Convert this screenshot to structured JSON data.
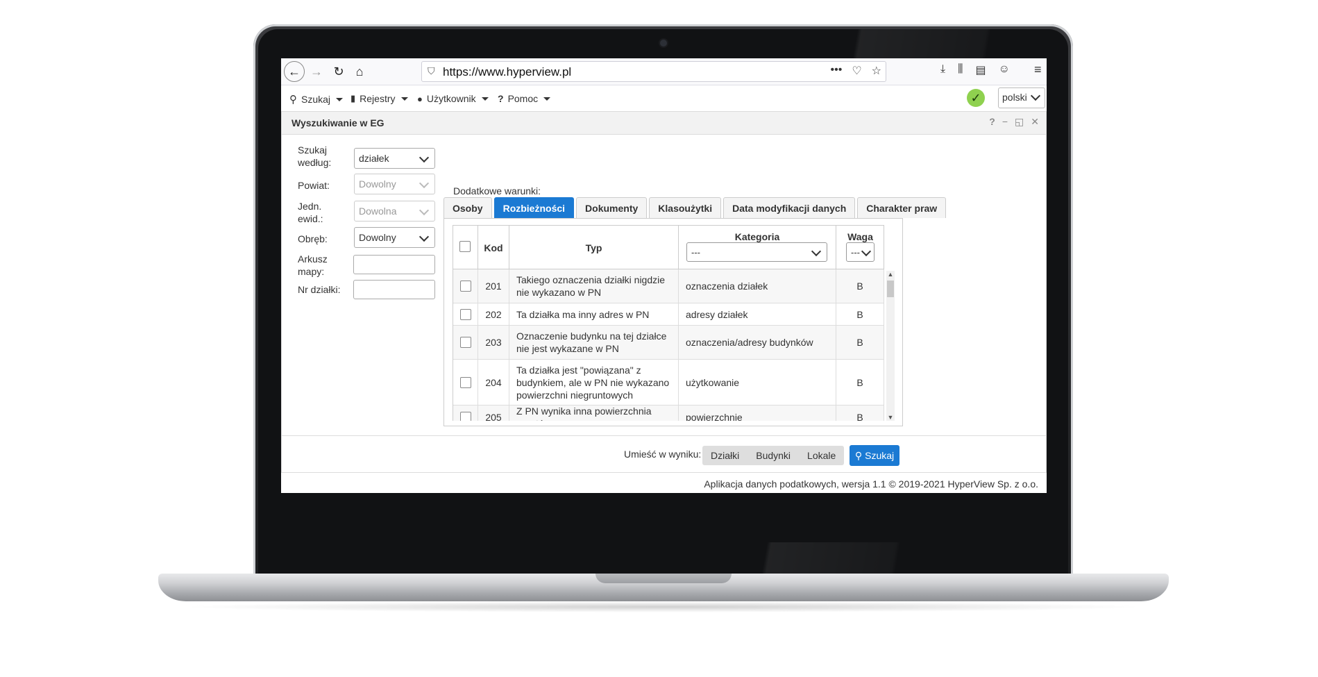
{
  "browser": {
    "url": "https://www.hyperview.pl"
  },
  "menu": {
    "search": "Szukaj",
    "registers": "Rejestry",
    "user": "Użytkownik",
    "help": "Pomoc",
    "help_glyph": "?",
    "language": "polski"
  },
  "panel": {
    "title": "Wyszukiwanie w EG",
    "help_glyph": "?"
  },
  "form": {
    "search_by_label": "Szukaj według:",
    "search_by_value": "działek",
    "county_label": "Powiat:",
    "county_value": "Dowolny",
    "unit_label": "Jedn. ewid.:",
    "unit_value": "Dowolna",
    "precinct_label": "Obręb:",
    "precinct_value": "Dowolny",
    "sheet_label": "Arkusz mapy:",
    "sheet_value": "",
    "parcel_label": "Nr działki:",
    "parcel_value": ""
  },
  "conditions": {
    "label": "Dodatkowe warunki:",
    "tabs": [
      "Osoby",
      "Rozbieżności",
      "Dokumenty",
      "Klasoużytki",
      "Data modyfikacji danych",
      "Charakter praw"
    ],
    "active_tab": 1
  },
  "table": {
    "headers": {
      "kod": "Kod",
      "typ": "Typ",
      "kategoria": "Kategoria",
      "waga": "Waga"
    },
    "kategoria_filter": "---",
    "waga_filter": "---",
    "rows": [
      {
        "kod": "201",
        "typ": "Takiego oznaczenia działki nigdzie nie wykazano w PN",
        "kategoria": "oznaczenia działek",
        "waga": "B"
      },
      {
        "kod": "202",
        "typ": "Ta działka ma inny adres w PN",
        "kategoria": "adresy działek",
        "waga": "B"
      },
      {
        "kod": "203",
        "typ": "Oznaczenie budynku na tej działce nie jest wykazane w PN",
        "kategoria": "oznaczenia/adresy budynków",
        "waga": "B"
      },
      {
        "kod": "204",
        "typ": "Ta działka jest \"powiązana\" z budynkiem, ale w PN nie wykazano powierzchni niegruntowych",
        "kategoria": "użytkowanie",
        "waga": "B"
      },
      {
        "kod": "205",
        "typ": "Z PN wynika inna powierzchnia gruntów",
        "kategoria": "powierzchnie",
        "waga": "B"
      }
    ]
  },
  "results": {
    "label": "Umieść w wyniku: *",
    "options": [
      "Działki",
      "Budynki",
      "Lokale"
    ],
    "search_button": "Szukaj"
  },
  "footer": {
    "text": "Aplikacja danych podatkowych, wersja 1.1 © 2019-2021 HyperView Sp. z o.o."
  },
  "colors": {
    "accent": "#1b7ad3",
    "status_ok": "#8fd14f"
  }
}
